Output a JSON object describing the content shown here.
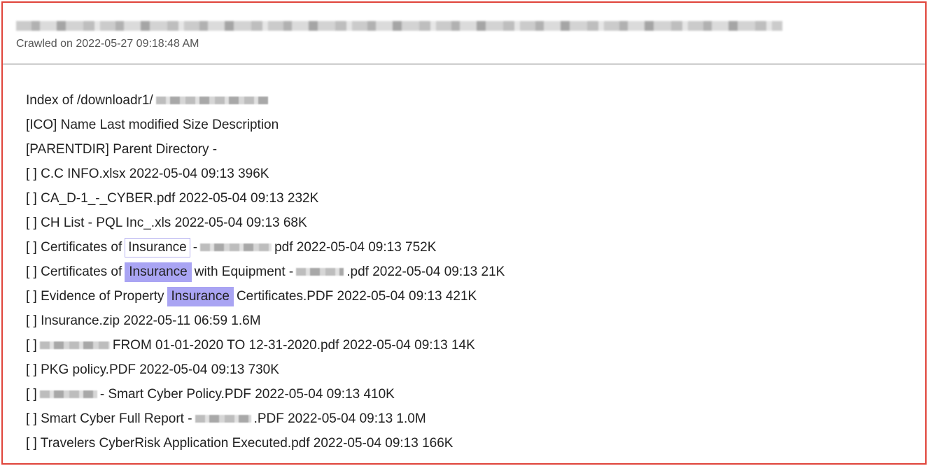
{
  "header": {
    "crawled": "Crawled on 2022-05-27 09:18:48 AM"
  },
  "listing": {
    "index_prefix": "Index of /downloadr1/",
    "columns": "[ICO] Name Last modified Size Description",
    "parent": "[PARENTDIR] Parent Directory -",
    "row1": "[ ] C.C INFO.xlsx 2022-05-04 09:13 396K",
    "row2": "[ ] CA_D-1_-_CYBER.pdf 2022-05-04 09:13 232K",
    "row3": "[ ] CH List - PQL Inc_.xls 2022-05-04 09:13 68K",
    "row4": {
      "pre": "[ ] Certificates of",
      "hl": "Insurance",
      "mid": "-",
      "post": "pdf 2022-05-04 09:13 752K"
    },
    "row5": {
      "pre": "[ ] Certificates of",
      "hl": "Insurance",
      "mid": "with Equipment -",
      "post": ".pdf 2022-05-04 09:13 21K"
    },
    "row6": {
      "pre": "[ ] Evidence of Property",
      "hl": "Insurance",
      "post": "Certificates.PDF 2022-05-04 09:13 421K"
    },
    "row7": "[ ] Insurance.zip 2022-05-11 06:59 1.6M",
    "row8": {
      "pre": "[ ]",
      "post": "FROM 01-01-2020 TO 12-31-2020.pdf 2022-05-04 09:13 14K"
    },
    "row9": "[ ] PKG policy.PDF 2022-05-04 09:13 730K",
    "row10": {
      "pre": "[ ]",
      "post": "- Smart Cyber Policy.PDF 2022-05-04 09:13 410K"
    },
    "row11": {
      "pre": "[ ] Smart Cyber Full Report -",
      "post": ".PDF 2022-05-04 09:13 1.0M"
    },
    "row12": "[ ] Travelers CyberRisk Application Executed.pdf 2022-05-04 09:13 166K"
  }
}
